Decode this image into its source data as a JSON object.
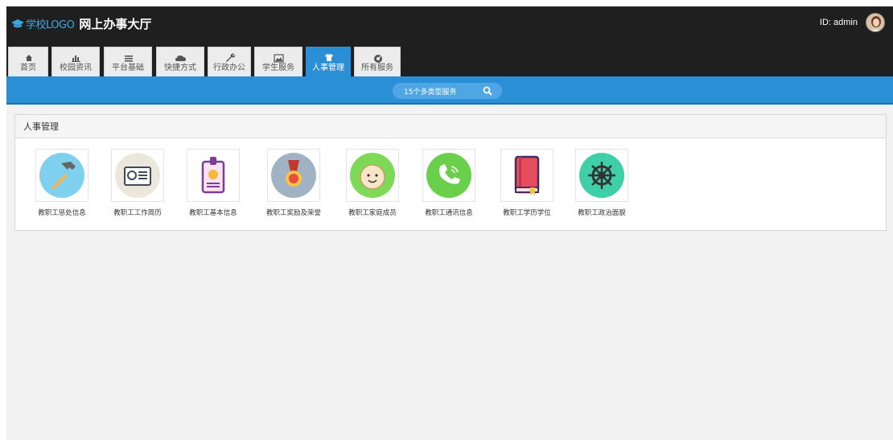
{
  "header": {
    "logo_text": "学校LOGO",
    "title": "网上办事大厅",
    "user_label": "ID: admin"
  },
  "tabs": [
    {
      "label": "首页",
      "icon": "home-icon"
    },
    {
      "label": "校园资讯",
      "icon": "bar-chart-icon"
    },
    {
      "label": "平台基础",
      "icon": "list-icon"
    },
    {
      "label": "快捷方式",
      "icon": "cloud-icon"
    },
    {
      "label": "行政办公",
      "icon": "wrench-icon"
    },
    {
      "label": "学生服务",
      "icon": "picture-icon"
    },
    {
      "label": "人事管理",
      "icon": "shirt-icon",
      "active": true
    },
    {
      "label": "所有服务",
      "icon": "dashboard-icon"
    }
  ],
  "search": {
    "text": "15个多类型服务"
  },
  "panel": {
    "title": "人事管理",
    "items": [
      {
        "label": "教职工惩处信息",
        "icon": "hammer-icon"
      },
      {
        "label": "教职工工作简历",
        "icon": "id-card-icon"
      },
      {
        "label": "教职工基本信息",
        "icon": "badge-icon"
      },
      {
        "label": "教职工奖励及荣誉",
        "icon": "medal-icon"
      },
      {
        "label": "教职工家庭成员",
        "icon": "baby-face-icon"
      },
      {
        "label": "教职工通讯信息",
        "icon": "phone-icon"
      },
      {
        "label": "教职工学历学位",
        "icon": "book-icon"
      },
      {
        "label": "教职工政治面貌",
        "icon": "ship-wheel-icon"
      }
    ]
  },
  "colors": {
    "topbar": "#1f1f1f",
    "accent": "#2b8fd6",
    "logo": "#3ca8e8"
  }
}
